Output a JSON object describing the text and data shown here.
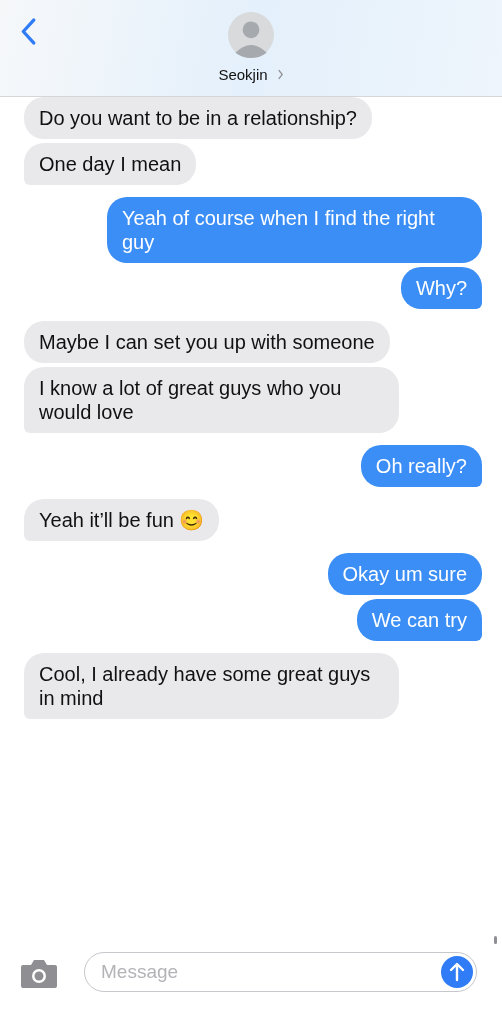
{
  "header": {
    "contact_name": "Seokjin"
  },
  "messages": [
    {
      "text": "Do you want to be in a relationship?",
      "outgoing": false,
      "tail": false
    },
    {
      "text": "One day I mean",
      "outgoing": false,
      "tail": true
    },
    {
      "text": "Yeah of course when I find the right guy",
      "outgoing": true,
      "tail": false
    },
    {
      "text": "Why?",
      "outgoing": true,
      "tail": true
    },
    {
      "text": "Maybe I can set you up with someone",
      "outgoing": false,
      "tail": false
    },
    {
      "text": "I know a lot of great guys who you would love",
      "outgoing": false,
      "tail": true
    },
    {
      "text": "Oh really?",
      "outgoing": true,
      "tail": true
    },
    {
      "text": "Yeah it’ll be fun 😊",
      "outgoing": false,
      "tail": true
    },
    {
      "text": "Okay um sure",
      "outgoing": true,
      "tail": false
    },
    {
      "text": "We can try",
      "outgoing": true,
      "tail": true
    },
    {
      "text": "Cool, I already have some great guys in mind",
      "outgoing": false,
      "tail": true
    }
  ],
  "composer": {
    "placeholder": "Message"
  }
}
